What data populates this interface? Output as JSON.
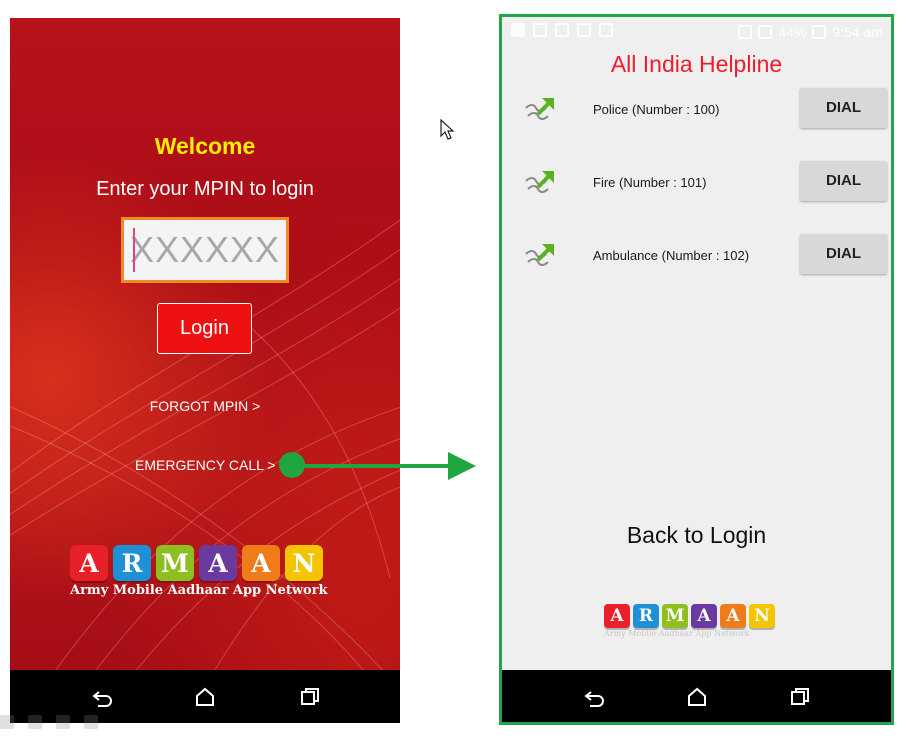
{
  "login_screen": {
    "welcome": "Welcome",
    "prompt": "Enter your MPIN to login",
    "mpin_placeholder": "XXXXXX",
    "login_label": "Login",
    "forgot_label": "FORGOT MPIN >",
    "emergency_label": "EMERGENCY CALL >",
    "logo": {
      "letters": [
        "A",
        "R",
        "M",
        "A",
        "A",
        "N"
      ],
      "tile_colors": [
        "#e8202a",
        "#1e90d6",
        "#8cbf1f",
        "#6b3aa0",
        "#f07b1a",
        "#f2c500"
      ],
      "tagline": "Army Mobile Aadhaar App Network"
    }
  },
  "helpline_screen": {
    "status_bar": {
      "battery": "44%",
      "time": "9:54 am"
    },
    "title": "All India Helpline",
    "rows": [
      {
        "label": "Police (Number : 100)",
        "action": "DIAL"
      },
      {
        "label": "Fire (Number : 101)",
        "action": "DIAL"
      },
      {
        "label": "Ambulance (Number : 102)",
        "action": "DIAL"
      }
    ],
    "back_label": "Back to Login",
    "logo": {
      "letters": [
        "A",
        "R",
        "M",
        "A",
        "A",
        "N"
      ],
      "tagline": "Army Mobile Aadhaar App Network"
    }
  },
  "navigation_icons": [
    "back-icon",
    "home-icon",
    "recents-icon"
  ],
  "colors": {
    "accent_red": "#ee1111",
    "welcome_yellow": "#ffee00",
    "helpline_title": "#ee1c2e",
    "flow_arrow": "#1fa640",
    "frame_green": "#22a64a"
  }
}
